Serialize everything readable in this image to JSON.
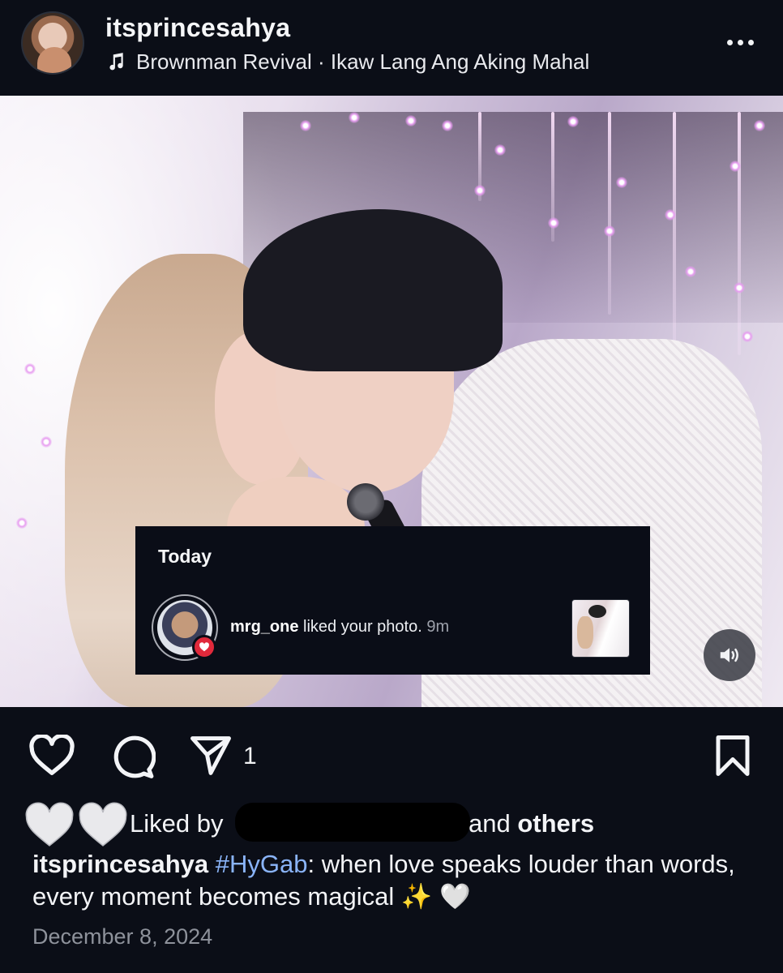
{
  "post": {
    "username": "itsprincesahya",
    "music": "Brownman Revival · Ikaw Lang Ang Aking Mahal"
  },
  "notification": {
    "section_title": "Today",
    "user": "mrg_one",
    "action": "liked your photo.",
    "time": "9m"
  },
  "actions": {
    "share_count": "1"
  },
  "likes": {
    "prefix": "Liked by",
    "connector": "and",
    "others": "others"
  },
  "caption": {
    "username": "itsprincesahya",
    "hashtag": "#HyGab",
    "text": ": when love speaks louder than words, every moment becomes magical ✨ 🤍"
  },
  "date": "December 8, 2024",
  "icons": {
    "music": "music-note-icon",
    "more": "more-options-icon",
    "sound": "sound-on-icon",
    "like": "heart-outline-icon",
    "comment": "comment-icon",
    "share": "send-icon",
    "save": "bookmark-icon",
    "notif_badge": "heart-badge-icon"
  },
  "colors": {
    "background": "#0b0e17",
    "hashtag": "#8ab4f8",
    "badge": "#e0293b",
    "muted_text": "#8e929b"
  }
}
